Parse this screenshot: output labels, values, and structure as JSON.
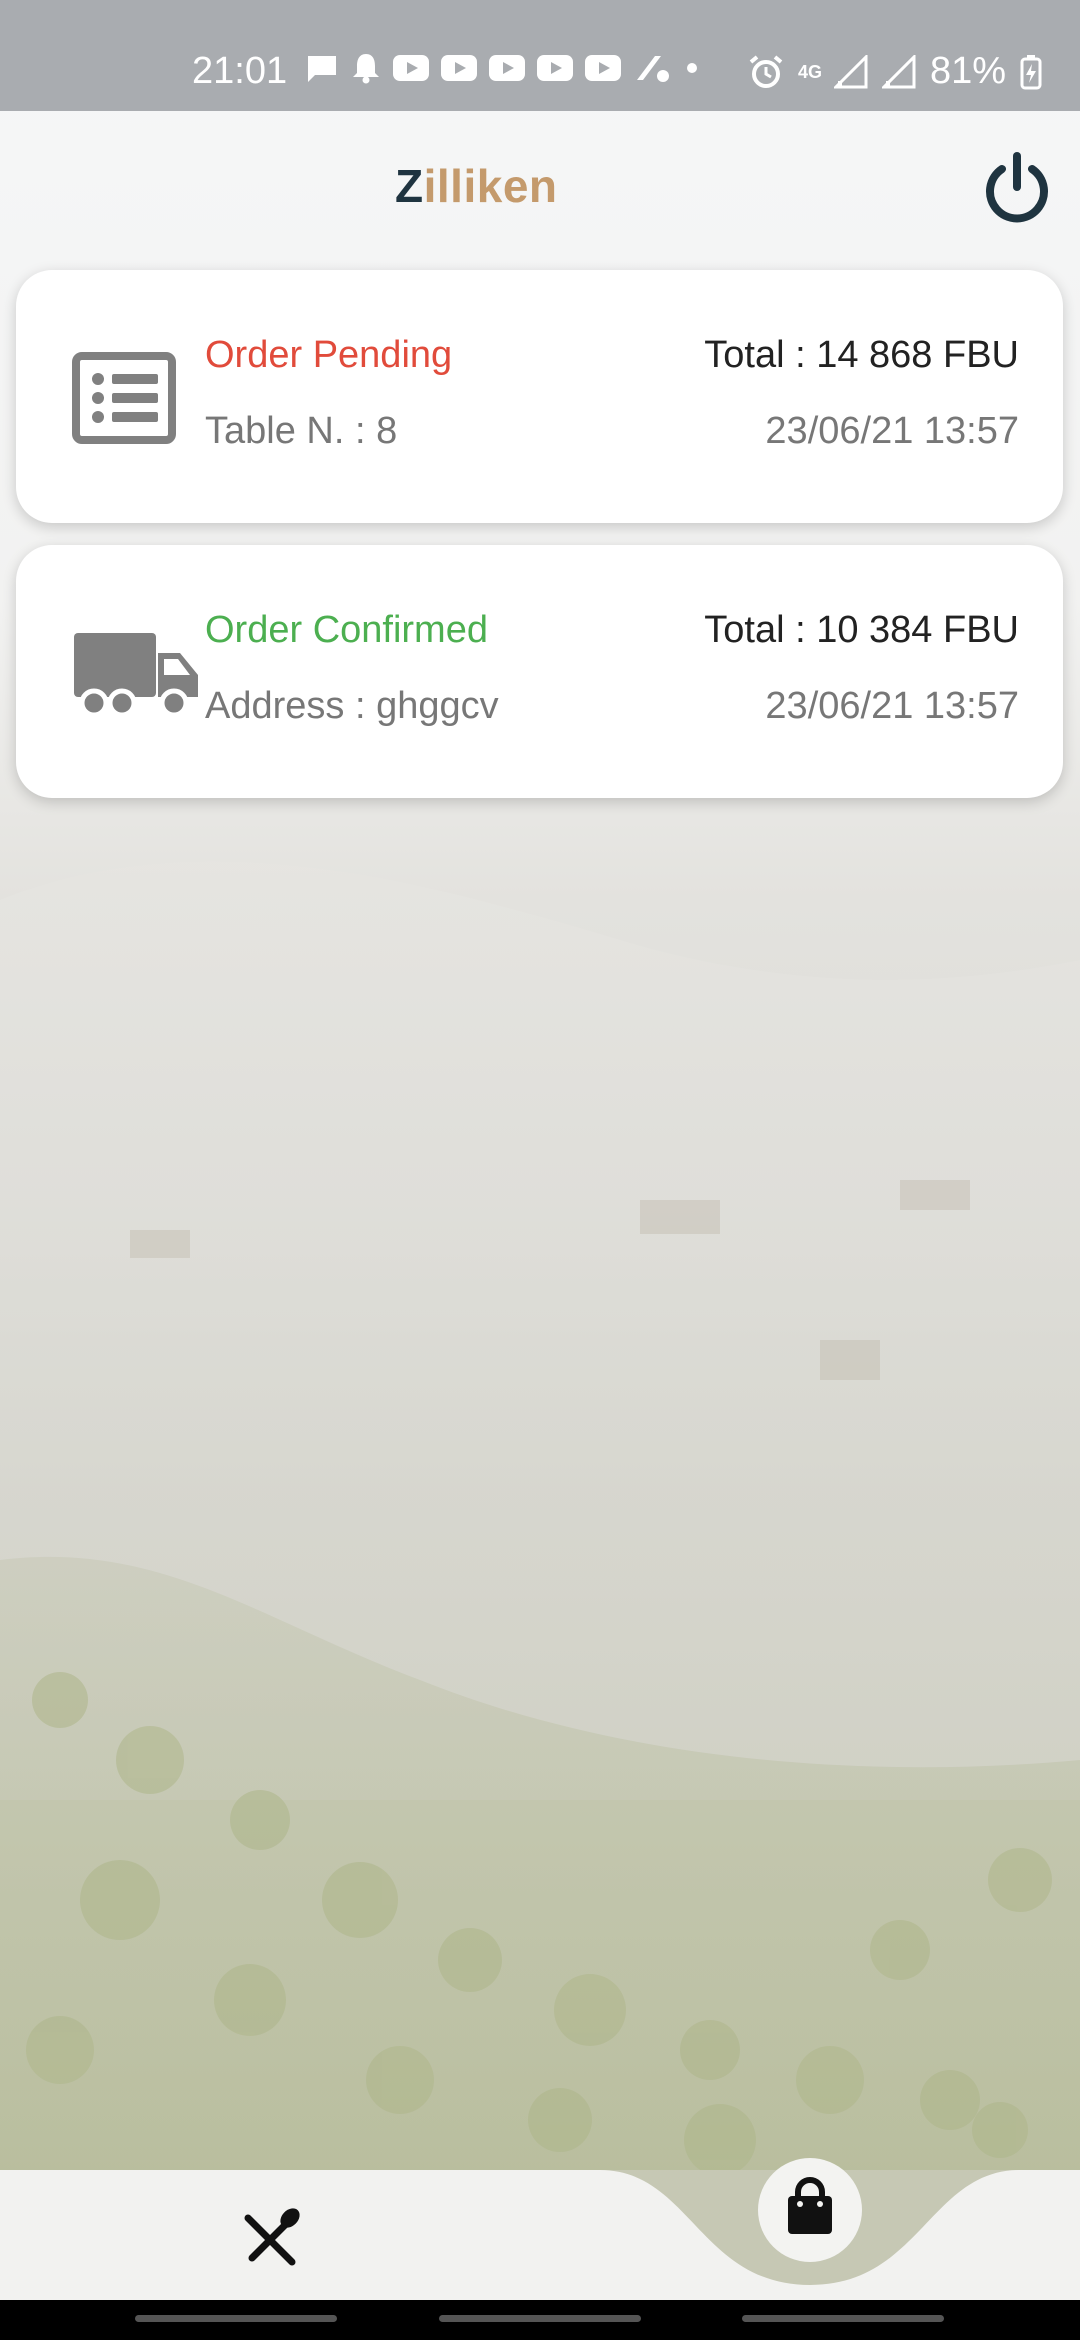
{
  "status_bar": {
    "time": "21:01",
    "network": "4G",
    "battery": "81%"
  },
  "header": {
    "title_first": "Z",
    "title_rest": "illiken",
    "power_icon": "power-icon"
  },
  "orders": [
    {
      "icon": "list-icon",
      "status": "Order Pending",
      "status_color": "#e14b3b",
      "detail": "Table N. : 8",
      "total": "Total : 14 868 FBU",
      "datetime": "23/06/21 13:57"
    },
    {
      "icon": "truck-icon",
      "status": "Order Confirmed",
      "status_color": "#4caf50",
      "detail": "Address : ghggcv",
      "total": "Total : 10 384 FBU",
      "datetime": "23/06/21 13:57"
    }
  ],
  "bottom_nav": {
    "left_icon": "cutlery-icon",
    "center_icon": "shopping-bag-icon"
  },
  "colors": {
    "brand_dark": "#1f3440",
    "brand_gold": "#c49a6c",
    "pending": "#e14b3b",
    "confirmed": "#4caf50"
  }
}
